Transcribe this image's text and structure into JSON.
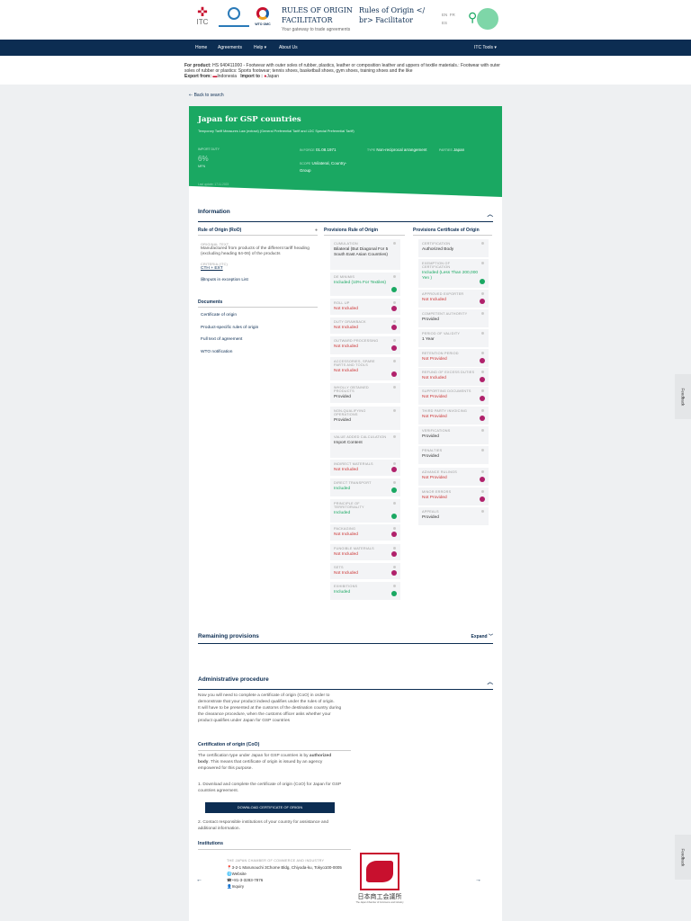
{
  "header": {
    "brand_itc": "ITC",
    "title": "RULES OF ORIGIN FACILITATOR",
    "tagline": "Your gateway to trade agreements",
    "subtitle": "Rules of Origin </ br> Facilitator",
    "lang_en": "EN",
    "lang_fr": "FR",
    "lang_es": "ES"
  },
  "nav": {
    "home": "Home",
    "agreements": "Agreements",
    "help": "Help ▾",
    "about": "About Us",
    "tools": "ITC Tools ▾"
  },
  "product": {
    "label": "For product:",
    "text": "HS 640411000 - Footwear with outer soles of rubber, plastics, leather or composition leather and uppers of textile materials.: Footwear with outer soles of rubber or plastics: Sports footwear; tennis shoes, basketball shoes, gym shoes, training shoes and the like",
    "export_label": "Export from:",
    "export": "Indonesia",
    "import_label": "Import to :",
    "import": "Japan"
  },
  "back": "⇠ Back to search",
  "agreement": {
    "title": "Japan for GSP countries",
    "subtitle": "Temporary Tariff Measures Law (extract) (General Preferential Tariff and LDC Special Preferential Tariff)",
    "import_duty_label": "IMPORT DUTY",
    "import_duty": "6%",
    "mfn": "MFN",
    "in_force_label": "IN FORCE",
    "in_force": "01.08.1971",
    "type_label": "TYPE",
    "type": "Non-reciprocal arrangement",
    "parties_label": "PARTIES",
    "parties": "Japan",
    "scope_label": "SCOPE",
    "scope": "Unilateral, Country-Group",
    "last_update": "Last update: 17.11.2023"
  },
  "info": {
    "title": "Information",
    "col1": "Rule of Origin (RoO)",
    "col2": "Provisions Rule of Origin",
    "col3": "Provisions Certificate of Origin",
    "orig_label": "ORIGINAL TEXT",
    "orig": "Manufactured from products of the different tariff heading (excluding heading 64-06) of the products",
    "criteria_label": "CRITERIA (ITC)",
    "criteria": "CTH + EXT",
    "exception": "Inputs in exception List",
    "docs_title": "Documents",
    "docs": [
      "Certificate of origin",
      "Product-specific rules of origin",
      "Full text of agreement",
      "WTO notification"
    ]
  },
  "roo_provisions": [
    {
      "label": "CUMULATION",
      "value": "Bilateral (But Diagonal For 5 South East Asian Countries)",
      "status": "neutral"
    },
    {
      "label": "DE MINIMIS",
      "value": "Included (10% For Textiles)",
      "status": "included"
    },
    {
      "label": "ROLL UP",
      "value": "Not Included",
      "status": "not"
    },
    {
      "label": "DUTY DRAWBACK",
      "value": "Not Included",
      "status": "not"
    },
    {
      "label": "OUTWARD PROCESSING",
      "value": "Not Included",
      "status": "not"
    },
    {
      "label": "ACCESSORIES, SPARE PARTS AND TOOLS",
      "value": "Not Included",
      "status": "not"
    },
    {
      "label": "WHOLLY OBTAINED PRODUCTS",
      "value": "Provided",
      "status": "neutral"
    },
    {
      "label": "NON-QUALIFYING OPERATIONS",
      "value": "Provided",
      "status": "neutral"
    },
    {
      "label": "VALUE ADDED CALCULATION",
      "value": "Import Content",
      "status": "neutral"
    },
    {
      "label": "INDIRECT MATERIALS",
      "value": "Not Included",
      "status": "not"
    },
    {
      "label": "DIRECT TRANSPORT",
      "value": "Included",
      "status": "included"
    },
    {
      "label": "PRINCIPLE OF TERRITORIALITY",
      "value": "Included",
      "status": "included"
    },
    {
      "label": "PACKAGING",
      "value": "Not Included",
      "status": "not"
    },
    {
      "label": "FUNGIBLE MATERIALS",
      "value": "Not Included",
      "status": "not"
    },
    {
      "label": "SETS",
      "value": "Not Included",
      "status": "not"
    },
    {
      "label": "EXHIBITIONS",
      "value": "Included",
      "status": "included"
    }
  ],
  "coo_provisions": [
    {
      "label": "CERTIFICATION",
      "value": "Authorized Body",
      "status": "neutral"
    },
    {
      "label": "EXEMPTION OF CERTIFICATION",
      "value": "Included (Less Than 200,000 Yen )",
      "status": "included"
    },
    {
      "label": "APPROVED EXPORTER",
      "value": "Not Included",
      "status": "not"
    },
    {
      "label": "COMPETENT AUTHORITY",
      "value": "Provided",
      "status": "neutral"
    },
    {
      "label": "PERIOD OF VALIDITY",
      "value": "1 Year",
      "status": "neutral"
    },
    {
      "label": "RETENTION PERIOD",
      "value": "Not Provided",
      "status": "not"
    },
    {
      "label": "REFUND OF EXCESS DUTIES",
      "value": "Not Included",
      "status": "not"
    },
    {
      "label": "SUPPORTING DOCUMENTS",
      "value": "Not Provided",
      "status": "not"
    },
    {
      "label": "THIRD PARTY INVOICING",
      "value": "Not Provided",
      "status": "not"
    },
    {
      "label": "VERIFICATIONS",
      "value": "Provided",
      "status": "neutral"
    },
    {
      "label": "PENALTIES",
      "value": "Provided",
      "status": "neutral"
    },
    {
      "label": "ADVANCE RULINGS",
      "value": "Not Provided",
      "status": "not"
    },
    {
      "label": "MINOR ERRORS",
      "value": "Not Provided",
      "status": "not"
    },
    {
      "label": "APPEALS",
      "value": "Provided",
      "status": "neutral"
    }
  ],
  "remaining": {
    "title": "Remaining provisions",
    "expand": "Expand"
  },
  "admin": {
    "title": "Administrative procedure",
    "p1": "Now you will need to complete a certificate of origin (CoO) in order to demonstrate that your product indeed qualifies under the rules of origin.",
    "p2": "It will have to be presented at the customs of the destination country during the clearance procedure, when the customs officer asks whether your product qualifies under Japan for GSP countries",
    "coo_title": "Certification of origin (CoO)",
    "p3a": "The certification type under Japan for GSP countries is by ",
    "p3b": "authorized body",
    "p3c": ". This means that certificate of origin is issued by an agency empowered for this purpose.",
    "step1": "1. Download and complete the certificate of origin (CoO) for Japan for GSP countries agreement.",
    "download": "DOWNLOAD CERTIFICATE OF ORIGIN",
    "step2": "2. Contact responsible institutions of your country for assistance and additional information.",
    "inst_title": "Institutions"
  },
  "institution": {
    "name": "THE JAPAN CHAMBER OF COMMERCE AND INDUSTRY",
    "address": "3-2-1 Marunouchi 3Chome Bldg, Chiyoda-ku, Tokyo100-0005",
    "website": "Website",
    "phone": "+81-3-3283-7876",
    "inquiry": "Inquiry",
    "logo_text": "日本商工会議所",
    "logo_sub": "The Japan Chamber of Commerce and Industry"
  },
  "feedback": "Feedback",
  "colors": {
    "navy": "#0c2d52",
    "green": "#1aa862",
    "red": "#b0216b"
  }
}
